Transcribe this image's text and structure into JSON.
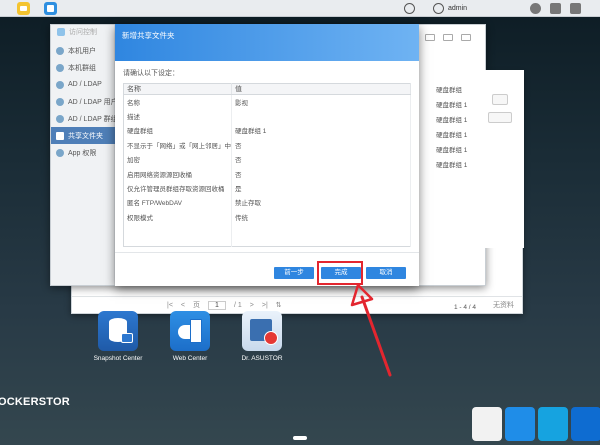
{
  "taskbar": {
    "user": "admin"
  },
  "access_control": {
    "title": "访问控制",
    "nav": [
      {
        "label": "本机用户",
        "icon": "user-icon"
      },
      {
        "label": "本机群组",
        "icon": "group-icon"
      },
      {
        "label": "AD / LDAP",
        "icon": "ad-icon"
      },
      {
        "label": "AD / LDAP 用户",
        "icon": "ad-user-icon"
      },
      {
        "label": "AD / LDAP 群组",
        "icon": "ad-group-icon"
      },
      {
        "label": "共享文件夹",
        "icon": "folder-icon",
        "active": true
      },
      {
        "label": "App 权限",
        "icon": "app-icon"
      }
    ],
    "list_rows": [
      "硬盘群组 1",
      "硬盘群组 1",
      "硬盘群组 1",
      "硬盘群组 1",
      "硬盘群组 1"
    ],
    "list_header": "硬盘群组",
    "count": "1 - 4 / 4"
  },
  "file_explorer": {
    "page_label": "页",
    "page_value": "1",
    "page_total": "/ 1",
    "no_data": "无资料"
  },
  "dialog": {
    "title": "新增共享文件夹",
    "intro": "请确认以下设定：",
    "table_headers": [
      "名称",
      "值"
    ],
    "rows": [
      {
        "key": "名称",
        "value": "影视"
      },
      {
        "key": "描述",
        "value": ""
      },
      {
        "key": "硬盘群组",
        "value": "硬盘群组 1"
      },
      {
        "key": "不显示于「网络」或「网上邻居」中",
        "value": "否"
      },
      {
        "key": "加密",
        "value": "否"
      },
      {
        "key": "启用网络资源源回收桶",
        "value": "否"
      },
      {
        "key": "仅允许管理员群组存取资源回收桶",
        "value": "是"
      },
      {
        "key": "匿名 FTP/WebDAV",
        "value": "禁止存取"
      },
      {
        "key": "权限模式",
        "value": "传统"
      }
    ],
    "buttons": {
      "prev": "前一步",
      "done": "完成",
      "cancel": "取消"
    }
  },
  "desktop": {
    "apps": [
      {
        "label": "Snapshot Center",
        "icon": "snapshot-center-icon"
      },
      {
        "label": "Web Center",
        "icon": "web-center-icon"
      },
      {
        "label": "Dr. ASUSTOR",
        "icon": "dr-asustor-icon"
      }
    ],
    "brand": "OCKERSTOR"
  },
  "colors": {
    "accent": "#2f86e0",
    "highlight": "#e3262f",
    "sidebar_active": "#4f7fb8"
  }
}
